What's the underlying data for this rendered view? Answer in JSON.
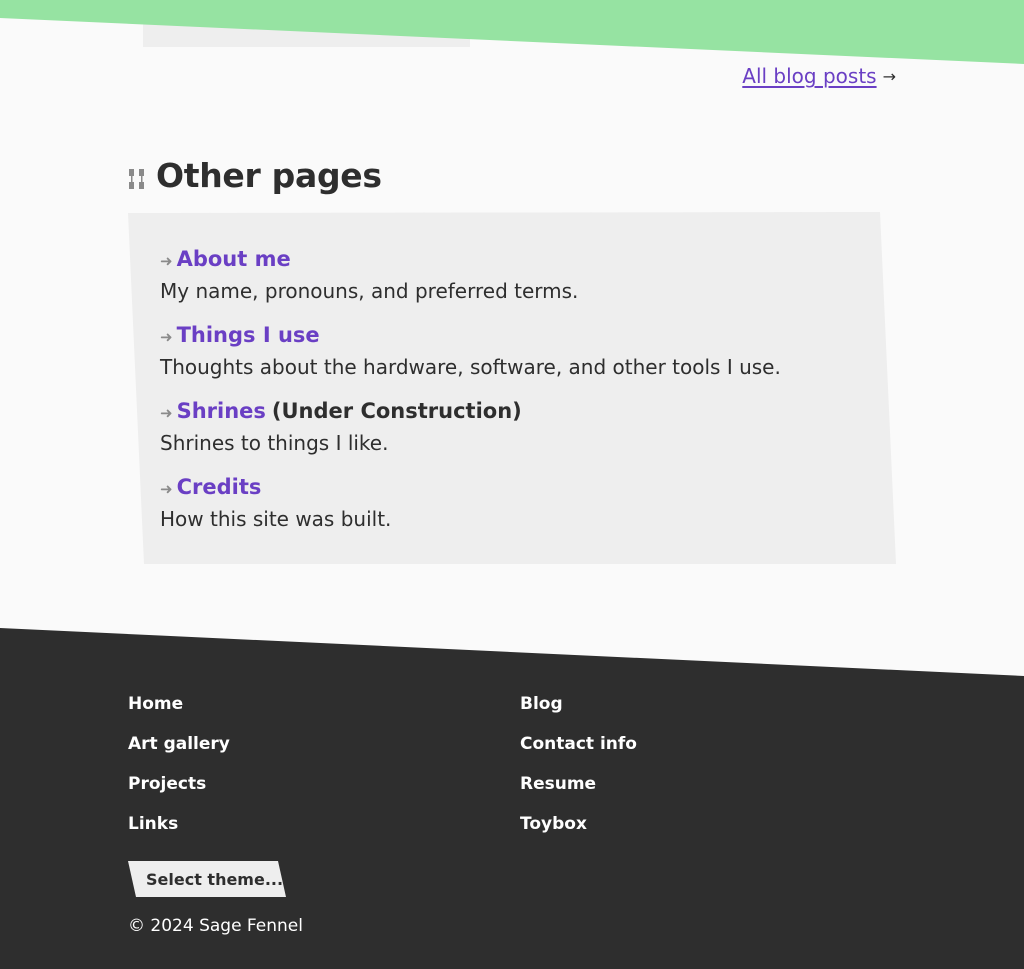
{
  "blog": {
    "all_posts_label": "All blog posts",
    "arrow": "→"
  },
  "other_pages": {
    "heading": "Other pages",
    "items": [
      {
        "title": "About me",
        "suffix": "",
        "description": "My name, pronouns, and preferred terms."
      },
      {
        "title": "Things I use",
        "suffix": "",
        "description": "Thoughts about the hardware, software, and other tools I use."
      },
      {
        "title": "Shrines",
        "suffix": "(Under Construction)",
        "description": "Shrines to things I like."
      },
      {
        "title": "Credits",
        "suffix": "",
        "description": "How this site was built."
      }
    ],
    "item_arrow": "➜"
  },
  "footer": {
    "links": [
      "Home",
      "Blog",
      "Art gallery",
      "Contact info",
      "Projects",
      "Resume",
      "Links",
      "Toybox"
    ],
    "theme_select_label": "Select theme...",
    "copyright": "© 2024 Sage Fennel"
  },
  "colors": {
    "accent_green": "#96e3a2",
    "link_purple": "#6a3fc4",
    "panel_bg": "#eeeeee",
    "footer_bg": "#2e2e2e"
  },
  "icons": {
    "heading_icon": "grip-icon",
    "footer_decoration": "slanted-band"
  }
}
